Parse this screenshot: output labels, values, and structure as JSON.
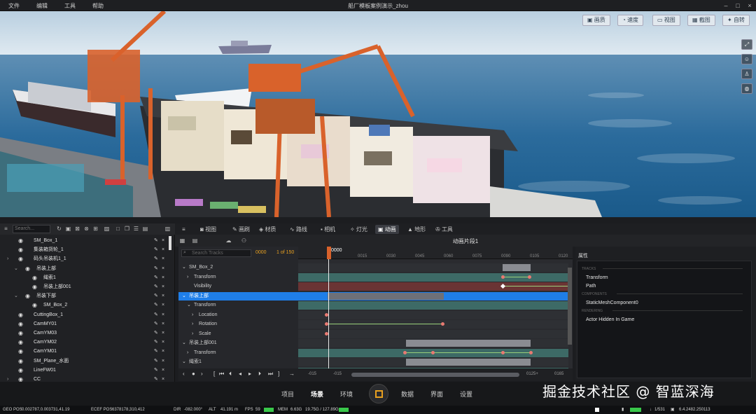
{
  "menubar": {
    "items": [
      "文件",
      "编辑",
      "工具",
      "帮助"
    ],
    "title": "船厂模板案例演示_zhou"
  },
  "viewport": {
    "toolbar": [
      "画质",
      "速度",
      "视图",
      "截图",
      "自转"
    ],
    "side_icons": [
      "expand-icon",
      "person-icon",
      "walk-icon",
      "globe-icon"
    ]
  },
  "outliner": {
    "search_placeholder": "Search...",
    "rows": [
      {
        "label": "SM_Box_1",
        "indent": 0,
        "arrow": ""
      },
      {
        "label": "集装箱货轮_1",
        "indent": 0,
        "arrow": ""
      },
      {
        "label": "码头吊装机1_1",
        "indent": 0,
        "arrow": "›"
      },
      {
        "label": "吊装上部",
        "indent": 1,
        "arrow": "⌄"
      },
      {
        "label": "绳索1",
        "indent": 2,
        "arrow": ""
      },
      {
        "label": "吊装上部001",
        "indent": 2,
        "arrow": ""
      },
      {
        "label": "吊装下部",
        "indent": 1,
        "arrow": "⌄"
      },
      {
        "label": "SM_Box_2",
        "indent": 2,
        "arrow": ""
      },
      {
        "label": "CuttingBox_1",
        "indent": 0,
        "arrow": ""
      },
      {
        "label": "CamMY01",
        "indent": 0,
        "arrow": ""
      },
      {
        "label": "CamYM03",
        "indent": 0,
        "arrow": ""
      },
      {
        "label": "CamYM02",
        "indent": 0,
        "arrow": ""
      },
      {
        "label": "CamYM01",
        "indent": 0,
        "arrow": ""
      },
      {
        "label": "SM_Plane_水面",
        "indent": 0,
        "arrow": ""
      },
      {
        "label": "LineFW01",
        "indent": 0,
        "arrow": ""
      },
      {
        "label": "CC",
        "indent": 0,
        "arrow": "›"
      }
    ]
  },
  "tabs": [
    {
      "label": "视图",
      "active": false
    },
    {
      "label": "画刷",
      "active": false
    },
    {
      "label": "材质",
      "active": false
    },
    {
      "label": "路线",
      "active": false
    },
    {
      "label": "相机",
      "active": false
    },
    {
      "label": "灯光",
      "active": false
    },
    {
      "label": "动画",
      "active": true
    },
    {
      "label": "地形",
      "active": false
    },
    {
      "label": "工具",
      "active": false
    }
  ],
  "clip": {
    "title": "动画片段1"
  },
  "sequencer": {
    "search_placeholder": "Search Tracks",
    "current_frame": "0000",
    "frame_count": "1 of 150",
    "playhead_label": "0000",
    "ruler": [
      "0000",
      "0015",
      "0030",
      "0045",
      "0060",
      "0075",
      "0090",
      "0105",
      "0120"
    ],
    "tracks": [
      {
        "label": "SM_Box_2",
        "indent": 1,
        "arrow": "⌄",
        "sel": false
      },
      {
        "label": "Transform",
        "indent": 2,
        "arrow": "›",
        "sel": false
      },
      {
        "label": "Visibility",
        "indent": 2,
        "arrow": "",
        "sel": false
      },
      {
        "label": "吊装上部",
        "indent": 1,
        "arrow": "⌄",
        "sel": true
      },
      {
        "label": "Transform",
        "indent": 2,
        "arrow": "⌄",
        "sel": false
      },
      {
        "label": "Location",
        "indent": 3,
        "arrow": "›",
        "sel": false
      },
      {
        "label": "Rotation",
        "indent": 3,
        "arrow": "›",
        "sel": false
      },
      {
        "label": "Scale",
        "indent": 3,
        "arrow": "›",
        "sel": false
      },
      {
        "label": "吊装上部001",
        "indent": 1,
        "arrow": "⌄",
        "sel": false
      },
      {
        "label": "Transform",
        "indent": 2,
        "arrow": "›",
        "sel": false
      },
      {
        "label": "绳索1",
        "indent": 1,
        "arrow": "⌄",
        "sel": false
      },
      {
        "label": "Transform",
        "indent": 2,
        "arrow": "›",
        "sel": false
      }
    ],
    "footer": {
      "range_left": "-015",
      "range_start": "-015",
      "range_end": "0125+",
      "range_right": "0165"
    }
  },
  "properties": {
    "title": "属性",
    "sections": [
      {
        "header": "TRACKS",
        "items": [
          "Transform",
          "Path"
        ]
      },
      {
        "header": "COMPONENTS",
        "items": [
          "StaticMeshComponent0"
        ]
      },
      {
        "header": "RENDERING",
        "items": [
          "Actor Hidden In Game"
        ]
      }
    ]
  },
  "bottomnav": {
    "items": [
      "项目",
      "场景",
      "环境",
      "数据",
      "界面",
      "设置"
    ],
    "active": "场景"
  },
  "status": {
    "geo_label": "GEO POS",
    "geo": "0.002787,0.003731,41.19",
    "ecef_label": "ECEF POS",
    "ecef": "6378178,310,412",
    "dir_label": "DIR",
    "dir": "-082.000°",
    "alt_label": "ALT",
    "alt": "41.191 m",
    "fps_label": "FPS",
    "fps": "59",
    "mem_label": "MEM",
    "mem": "6.63G",
    "gpu": "19.75G / 127.89G",
    "page": "1/531",
    "coord": "6.4.2482.250113"
  },
  "watermark": "掘金技术社区 @ 智蓝深海"
}
